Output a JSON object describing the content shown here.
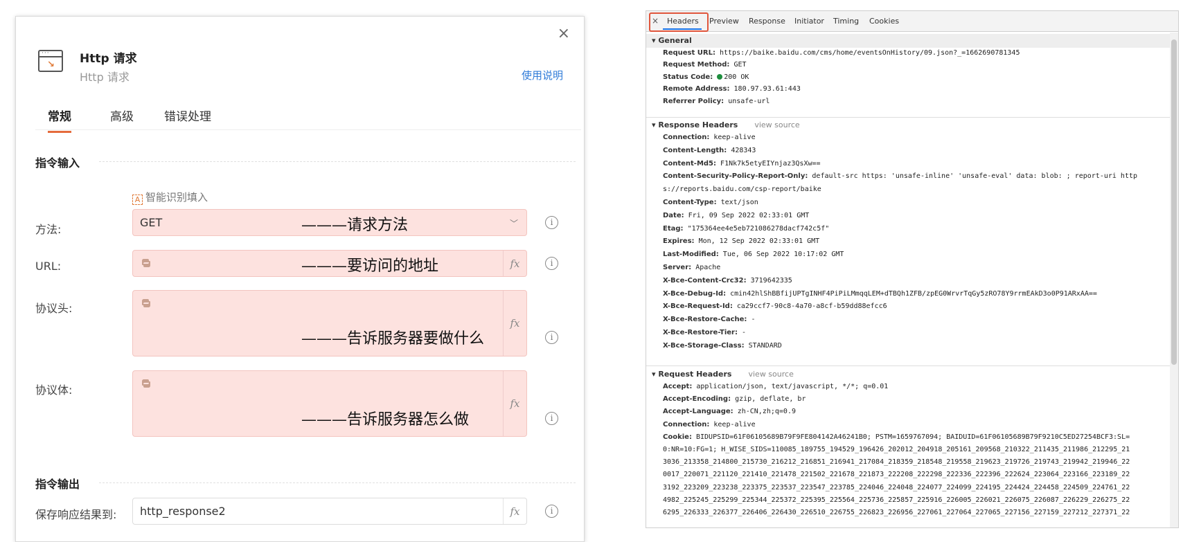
{
  "dialog": {
    "title": "Http 请求",
    "subtitle": "Http 请求",
    "help_link": "使用说明",
    "close": "×",
    "tabs": [
      {
        "label": "常规"
      },
      {
        "label": "高级"
      },
      {
        "label": "错误处理"
      }
    ],
    "section_input": "指令输入",
    "section_output": "指令输出",
    "smart_fill": "智能识别填入",
    "fields": {
      "method": {
        "label": "方法:",
        "value": "GET",
        "annotation": "———请求方法"
      },
      "url": {
        "label": "URL:",
        "annotation": "———要访问的地址"
      },
      "headers": {
        "label": "协议头:",
        "annotation": "———告诉服务器要做什么"
      },
      "body": {
        "label": "协议体:",
        "annotation": "———告诉服务器怎么做"
      },
      "save": {
        "label": "保存响应结果到:",
        "value": "http_response2"
      }
    },
    "fx": "fx",
    "info": "i"
  },
  "devtools": {
    "close": "×",
    "tabs": [
      "Headers",
      "Preview",
      "Response",
      "Initiator",
      "Timing",
      "Cookies"
    ],
    "active_tab": "Headers",
    "general": {
      "title": "▾ General",
      "rows": [
        {
          "k": "Request URL:",
          "v": "https://baike.baidu.com/cms/home/eventsOnHistory/09.json?_=1662690781345"
        },
        {
          "k": "Request Method:",
          "v": "GET"
        },
        {
          "k": "Status Code:",
          "v": "200 OK"
        },
        {
          "k": "Remote Address:",
          "v": "180.97.93.61:443"
        },
        {
          "k": "Referrer Policy:",
          "v": "unsafe-url"
        }
      ]
    },
    "response_headers": {
      "title": "▾ Response Headers",
      "view_source": "view source",
      "rows": [
        {
          "k": "Connection:",
          "v": "keep-alive"
        },
        {
          "k": "Content-Length:",
          "v": "428343"
        },
        {
          "k": "Content-Md5:",
          "v": "F1Nk7k5etyEIYnjaz3QsXw=="
        },
        {
          "k": "Content-Security-Policy-Report-Only:",
          "v": "default-src https: 'unsafe-inline' 'unsafe-eval' data: blob: ; report-uri http"
        },
        {
          "k": "",
          "v": "s://reports.baidu.com/csp-report/baike"
        },
        {
          "k": "Content-Type:",
          "v": "text/json"
        },
        {
          "k": "Date:",
          "v": "Fri, 09 Sep 2022 02:33:01 GMT"
        },
        {
          "k": "Etag:",
          "v": "\"175364ee4e5eb721086278dacf742c5f\""
        },
        {
          "k": "Expires:",
          "v": "Mon, 12 Sep 2022 02:33:01 GMT"
        },
        {
          "k": "Last-Modified:",
          "v": "Tue, 06 Sep 2022 10:17:02 GMT"
        },
        {
          "k": "Server:",
          "v": "Apache"
        },
        {
          "k": "X-Bce-Content-Crc32:",
          "v": "3719642335"
        },
        {
          "k": "X-Bce-Debug-Id:",
          "v": "cmin42hlShBBfijUPTgINHF4PiPiLMmqqLEM+dTBQh1ZFB/zpEG0WrvrTqGy5zRO78Y9rrmEAkD3o0P91ARxAA=="
        },
        {
          "k": "X-Bce-Request-Id:",
          "v": "ca29ccf7-90c8-4a70-a8cf-b59dd88efcc6"
        },
        {
          "k": "X-Bce-Restore-Cache:",
          "v": "-"
        },
        {
          "k": "X-Bce-Restore-Tier:",
          "v": "-"
        },
        {
          "k": "X-Bce-Storage-Class:",
          "v": "STANDARD"
        }
      ]
    },
    "request_headers": {
      "title": "▾ Request Headers",
      "view_source": "view source",
      "rows": [
        {
          "k": "Accept:",
          "v": "application/json, text/javascript, */*; q=0.01"
        },
        {
          "k": "Accept-Encoding:",
          "v": "gzip, deflate, br"
        },
        {
          "k": "Accept-Language:",
          "v": "zh-CN,zh;q=0.9"
        },
        {
          "k": "Connection:",
          "v": "keep-alive"
        },
        {
          "k": "Cookie:",
          "v": "BIDUPSID=61F06105689B79F9FE804142A46241B0; PSTM=1659767094; BAIDUID=61F06105689B79F9210C5ED27254BCF3:SL="
        },
        {
          "k": "",
          "v": "0:NR=10:FG=1; H_WISE_SIDS=110085_189755_194529_196426_202012_204918_205161_209568_210322_211435_211986_212295_21"
        },
        {
          "k": "",
          "v": "3036_213358_214800_215730_216212_216851_216941_217084_218359_218548_219558_219623_219726_219743_219942_219946_22"
        },
        {
          "k": "",
          "v": "0017_220071_221120_221410_221478_221502_221678_221873_222208_222298_222336_222396_222624_223064_223166_223189_22"
        },
        {
          "k": "",
          "v": "3192_223209_223238_223375_223537_223547_223785_224046_224048_224077_224099_224195_224424_224458_224509_224761_22"
        },
        {
          "k": "",
          "v": "4982_225245_225299_225344_225372_225395_225564_225736_225857_225916_226005_226021_226075_226087_226229_226275_22"
        },
        {
          "k": "",
          "v": "6295_226333_226377_226406_226430_226510_226755_226823_226956_227061_227064_227065_227156_227159_227212_227371_22"
        }
      ]
    }
  },
  "colors": {
    "accent": "#e56b3c",
    "link": "#2f7bd8",
    "field_highlight": "#fde2df",
    "devtools_tab_underline": "#1a73e8",
    "status_green": "#1e8e3e"
  }
}
